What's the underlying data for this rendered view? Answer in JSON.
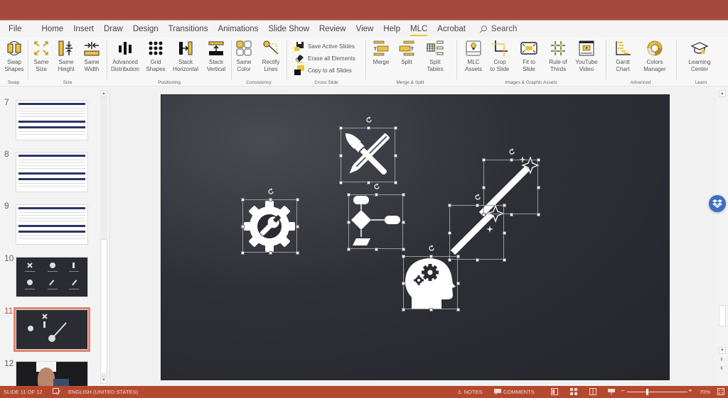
{
  "menu": {
    "tabs": [
      "File",
      "Home",
      "Insert",
      "Draw",
      "Design",
      "Transitions",
      "Animations",
      "Slide Show",
      "Review",
      "View",
      "Help",
      "MLC",
      "Acrobat"
    ],
    "active_tab": "MLC",
    "search_label": "Search"
  },
  "ribbon": {
    "groups": {
      "swap": "Swap",
      "size": "Size",
      "positioning": "Positioning",
      "consistency": "Consistency",
      "cross_slide": "Cross Slide",
      "merge_split": "Merge & Split",
      "images": "Images & Graphic Assets",
      "advanced": "Advanced",
      "learn": "Learn"
    },
    "buttons": {
      "swap_shapes": [
        "Swap",
        "Shapes"
      ],
      "same_size": [
        "Same",
        "Size"
      ],
      "same_height": [
        "Same",
        "Height"
      ],
      "same_width": [
        "Same",
        "Width"
      ],
      "advanced_distribution": [
        "Advanced",
        "Distribution"
      ],
      "grid_shapes": [
        "Grid",
        "Shapes"
      ],
      "stack_horizontal": [
        "Stack",
        "Horizontal"
      ],
      "stack_vertical": [
        "Stack",
        "Vertical"
      ],
      "same_color": [
        "Same",
        "Color"
      ],
      "rectify_lines": [
        "Rectify",
        "Lines"
      ],
      "save_active_slides": "Save Active Slides",
      "erase_all_elements": "Erase all Elements",
      "copy_to_all_slides": "Copy to all Slides",
      "merge": [
        "Merge",
        ""
      ],
      "split": [
        "Split",
        ""
      ],
      "split_tables": [
        "Split",
        "Tables"
      ],
      "mlc_assets": [
        "MLC",
        "Assets"
      ],
      "crop_to_slide": [
        "Crop",
        "to Slide"
      ],
      "fit_to_slide": [
        "Fit to",
        "Slide"
      ],
      "rule_of_thirds": [
        "Rule of",
        "Thirds"
      ],
      "youtube_video": [
        "YouTube",
        "Video"
      ],
      "gantt_chart": [
        "Gantt",
        "Chart"
      ],
      "colors_manager": [
        "Colors",
        "Manager"
      ],
      "learning_center": [
        "Learning",
        "Center"
      ]
    },
    "accent_color": "#f0c23a"
  },
  "slides_panel": {
    "thumbnails": [
      {
        "number": "7",
        "kind": "table"
      },
      {
        "number": "8",
        "kind": "table"
      },
      {
        "number": "9",
        "kind": "table"
      },
      {
        "number": "10",
        "kind": "icons-grid"
      },
      {
        "number": "11",
        "kind": "icons-scatter",
        "selected": true
      },
      {
        "number": "12",
        "kind": "photo"
      }
    ]
  },
  "slide": {
    "shapes": [
      "gear-wrench",
      "pencil-brush",
      "flowchart",
      "magic-wand-upper",
      "magic-wand-lower",
      "head-gears"
    ]
  },
  "status_bar": {
    "slide_info": "SLIDE 11 OF 12",
    "language": "ENGLISH (UNITED STATES)",
    "notes": "NOTES",
    "comments": "COMMENTS",
    "zoom_minus": "−",
    "zoom_plus": "+",
    "zoom_level": "70%",
    "zoom_fraction": 0.33
  },
  "colors": {
    "title_bar": "#a5493e",
    "status_bar": "#b4492f",
    "selected_thumb": "#e0866f",
    "dropbox": "#3d6fc2"
  }
}
